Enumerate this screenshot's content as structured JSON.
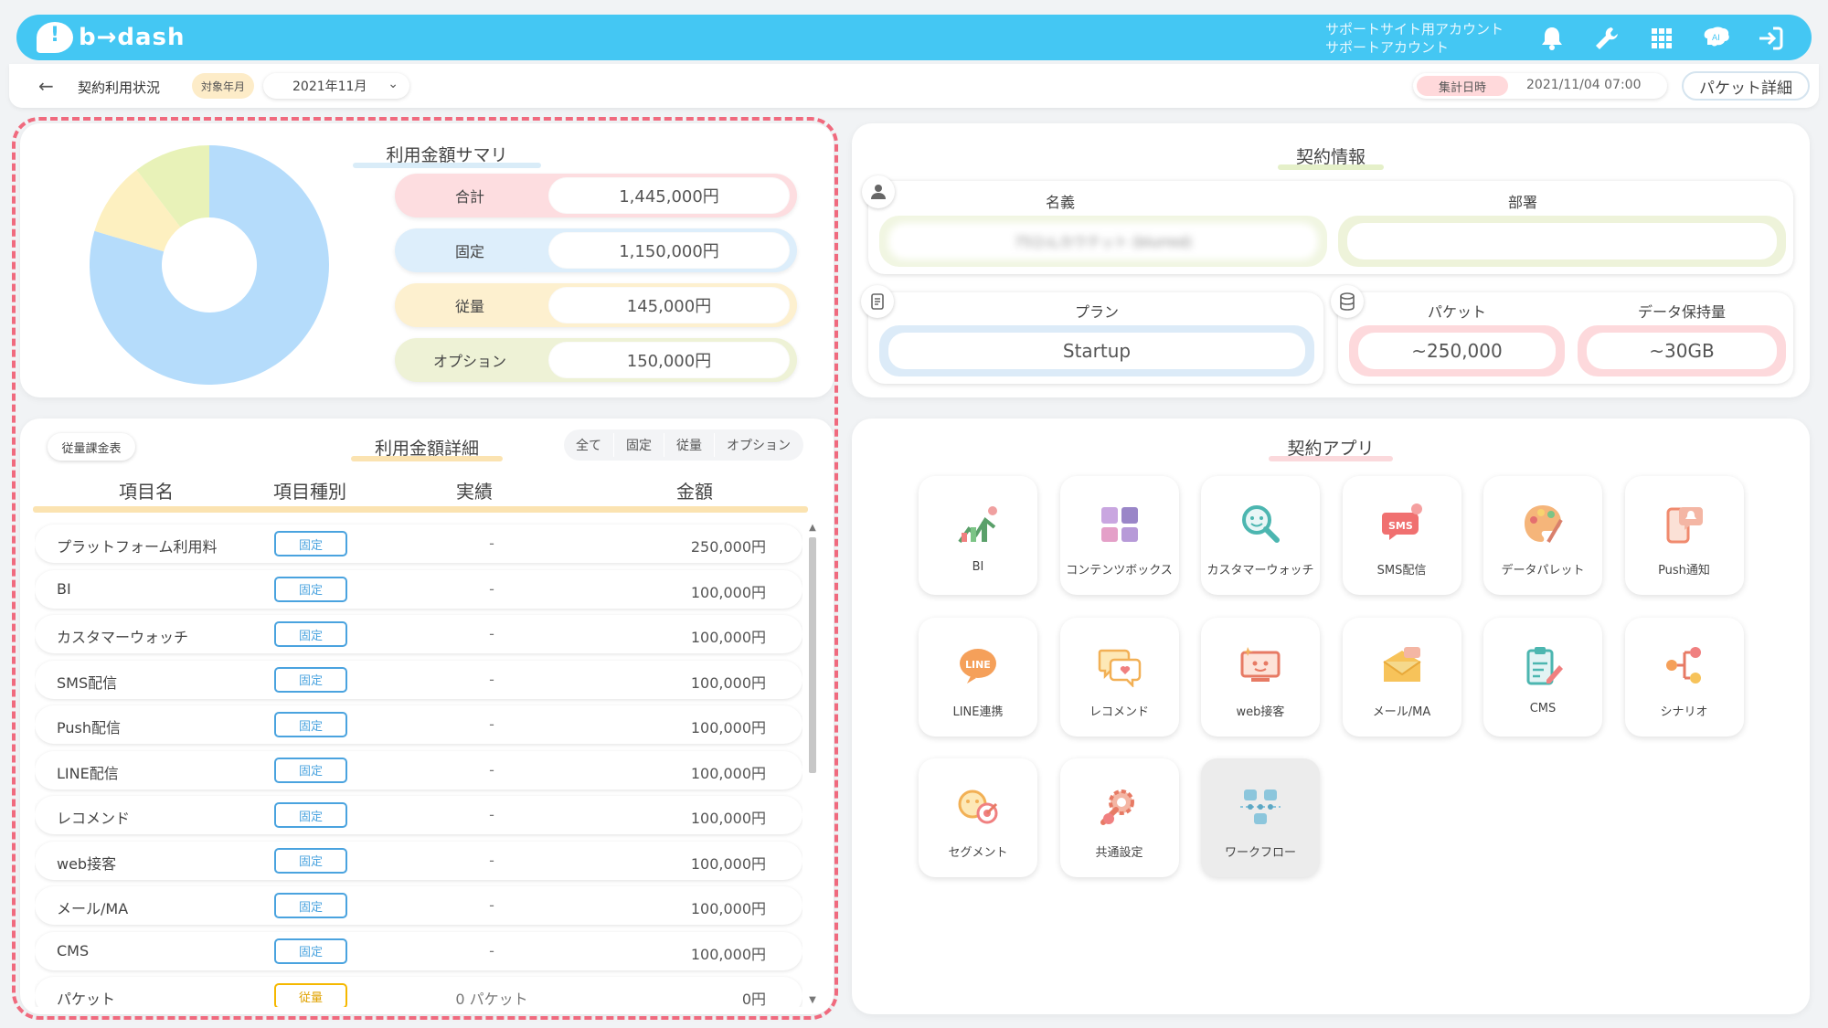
{
  "header": {
    "brand": "b→dash",
    "account_line1": "サポートサイト用アカウント",
    "account_line2": "サポートアカウント",
    "icons": [
      "bell-icon",
      "wrench-icon",
      "apps-grid-icon",
      "brain-icon",
      "logout-icon"
    ]
  },
  "subbar": {
    "back_icon": "arrow-left-icon",
    "title": "契約利用状況",
    "period_label": "対象年月",
    "period_value": "2021年11月",
    "aggregation_label": "集計日時",
    "aggregation_value": "2021/11/04 07:00",
    "packet_detail_button": "パケット詳細"
  },
  "summary": {
    "title": "利用金額サマリ",
    "rows": [
      {
        "label": "合計",
        "value": "1,445,000円",
        "color": "#fddde0"
      },
      {
        "label": "固定",
        "value": "1,150,000円",
        "color": "#ddeefb"
      },
      {
        "label": "従量",
        "value": "145,000円",
        "color": "#fdf0cf"
      },
      {
        "label": "オプション",
        "value": "150,000円",
        "color": "#eef2d6"
      }
    ],
    "donut": [
      {
        "label": "固定",
        "value": 1150000,
        "color": "#b5dcfb"
      },
      {
        "label": "従量",
        "value": 145000,
        "color": "#fdf0c0"
      },
      {
        "label": "オプション",
        "value": 150000,
        "color": "#e8f2b8"
      }
    ]
  },
  "detail": {
    "title": "利用金額詳細",
    "tag_button": "従量課金表",
    "filters": [
      "全て",
      "固定",
      "従量",
      "オプション"
    ],
    "columns": [
      "項目名",
      "項目種別",
      "実績",
      "金額"
    ],
    "rows": [
      {
        "name": "プラットフォーム利用料",
        "type": "固定",
        "actual": "-",
        "amount": "250,000円"
      },
      {
        "name": "BI",
        "type": "固定",
        "actual": "-",
        "amount": "100,000円"
      },
      {
        "name": "カスタマーウォッチ",
        "type": "固定",
        "actual": "-",
        "amount": "100,000円"
      },
      {
        "name": "SMS配信",
        "type": "固定",
        "actual": "-",
        "amount": "100,000円"
      },
      {
        "name": "Push配信",
        "type": "固定",
        "actual": "-",
        "amount": "100,000円"
      },
      {
        "name": "LINE配信",
        "type": "固定",
        "actual": "-",
        "amount": "100,000円"
      },
      {
        "name": "レコメンド",
        "type": "固定",
        "actual": "-",
        "amount": "100,000円"
      },
      {
        "name": "web接客",
        "type": "固定",
        "actual": "-",
        "amount": "100,000円"
      },
      {
        "name": "メール/MA",
        "type": "固定",
        "actual": "-",
        "amount": "100,000円"
      },
      {
        "name": "CMS",
        "type": "固定",
        "actual": "-",
        "amount": "100,000円"
      },
      {
        "name": "パケット",
        "type": "従量",
        "actual": "0 パケット",
        "amount": "0円"
      }
    ]
  },
  "contract": {
    "title": "契約情報",
    "name_label": "名義",
    "name_value": "75ひんカウテット (blurred)",
    "dept_label": "部署",
    "dept_value": "",
    "plan_label": "プラン",
    "plan_value": "Startup",
    "packet_label": "パケット",
    "packet_value": "~250,000",
    "storage_label": "データ保持量",
    "storage_value": "~30GB"
  },
  "apps": {
    "title": "契約アプリ",
    "items": [
      {
        "label": "BI",
        "icon": "bi-chart-icon"
      },
      {
        "label": "コンテンツボックス",
        "icon": "content-box-icon"
      },
      {
        "label": "カスタマーウォッチ",
        "icon": "magnifier-face-icon"
      },
      {
        "label": "SMS配信",
        "icon": "sms-bubble-icon"
      },
      {
        "label": "データパレット",
        "icon": "palette-icon"
      },
      {
        "label": "Push通知",
        "icon": "push-phone-icon"
      },
      {
        "label": "LINE連携",
        "icon": "line-bubble-icon"
      },
      {
        "label": "レコメンド",
        "icon": "recommend-bubble-icon"
      },
      {
        "label": "web接客",
        "icon": "web-monitor-icon"
      },
      {
        "label": "メール/MA",
        "icon": "mail-envelope-icon"
      },
      {
        "label": "CMS",
        "icon": "clipboard-pen-icon"
      },
      {
        "label": "シナリオ",
        "icon": "scenario-flow-icon"
      },
      {
        "label": "セグメント",
        "icon": "segment-target-icon"
      },
      {
        "label": "共通設定",
        "icon": "settings-tools-icon"
      },
      {
        "label": "ワークフロー",
        "icon": "workflow-icon"
      }
    ]
  }
}
